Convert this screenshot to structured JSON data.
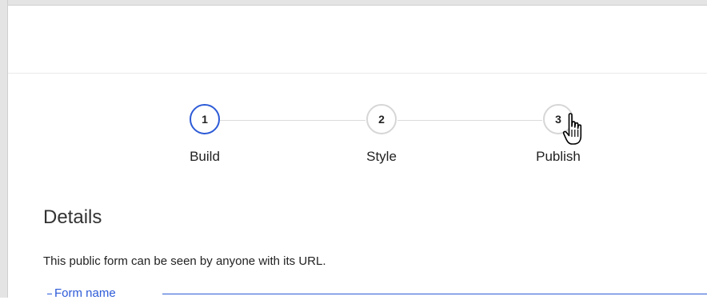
{
  "stepper": {
    "steps": [
      {
        "number": "1",
        "label": "Build",
        "state": "active"
      },
      {
        "number": "2",
        "label": "Style",
        "state": "inactive"
      },
      {
        "number": "3",
        "label": "Publish",
        "state": "inactive"
      }
    ]
  },
  "details": {
    "title": "Details",
    "description": "This public form can be seen by anyone with its URL.",
    "form_name_label": "Form name"
  },
  "colors": {
    "accent": "#2d5bd7",
    "inactive_border": "#d6d6d6"
  },
  "icons": {
    "cursor": "hand-pointer-icon"
  }
}
